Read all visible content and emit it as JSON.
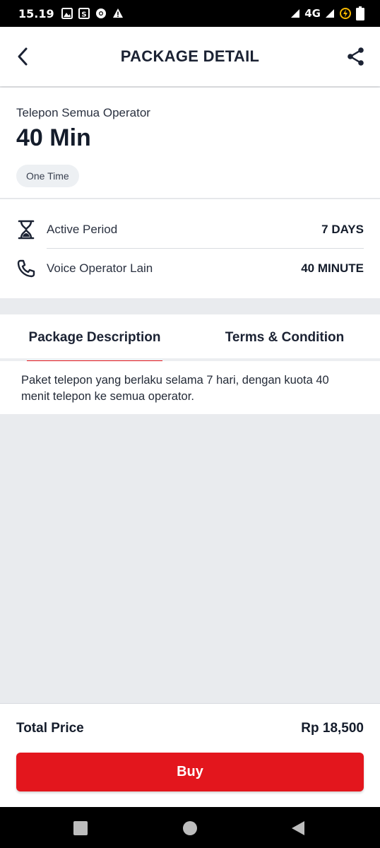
{
  "status_bar": {
    "time": "15.19",
    "network": "4G"
  },
  "header": {
    "title": "PACKAGE DETAIL"
  },
  "package": {
    "subtitle": "Telepon Semua Operator",
    "quota": "40 Min",
    "type_chip": "One Time"
  },
  "details": [
    {
      "icon": "hourglass-icon",
      "label": "Active Period",
      "value": "7 DAYS"
    },
    {
      "icon": "phone-icon",
      "label": "Voice Operator Lain",
      "value": "40 MINUTE"
    }
  ],
  "tabs": [
    {
      "label": "Package Description",
      "active": true
    },
    {
      "label": "Terms & Condition",
      "active": false
    }
  ],
  "description": "Paket telepon yang berlaku selama 7 hari, dengan kuota 40 menit telepon ke semua operator.",
  "footer": {
    "total_label": "Total Price",
    "total_value": "Rp 18,500",
    "buy_label": "Buy"
  },
  "colors": {
    "accent": "#e3161d",
    "text": "#1b2233",
    "background": "#e9ebee"
  }
}
